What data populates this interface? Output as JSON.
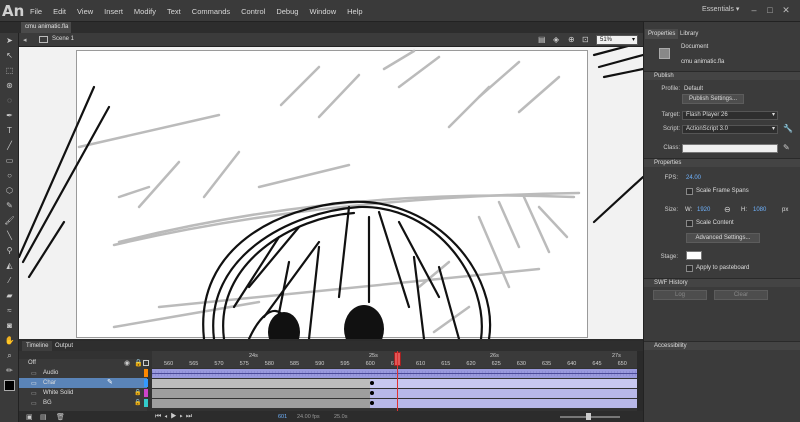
{
  "app": {
    "logo": "An"
  },
  "menu": [
    "File",
    "Edit",
    "View",
    "Insert",
    "Modify",
    "Text",
    "Commands",
    "Control",
    "Debug",
    "Window",
    "Help"
  ],
  "workspace": "Essentials",
  "window_buttons": {
    "minimize": "–",
    "maximize": "□",
    "close": "✕"
  },
  "document_tab": {
    "label": "cmu animatic.fla",
    "close": "×"
  },
  "editbar": {
    "scene": "Scene 1",
    "zoom": "51%"
  },
  "colors": {
    "accent": "#6fb3ff",
    "playhead": "#e03030",
    "purple_frames": "#9999dd",
    "stage": "#ffffff"
  },
  "timeline": {
    "tabs": [
      "Timeline",
      "Output"
    ],
    "off_label": "Off",
    "layers": [
      {
        "name": "Audio",
        "color": "#ff8800",
        "selected": false
      },
      {
        "name": "Char",
        "color": "#3399ff",
        "selected": true
      },
      {
        "name": "White Solid",
        "color": "#cc44cc",
        "selected": false
      },
      {
        "name": "BG",
        "color": "#33cccc",
        "selected": false
      }
    ],
    "frame_numbers": [
      "560",
      "565",
      "570",
      "575",
      "580",
      "585",
      "590",
      "595",
      "600",
      "605",
      "610",
      "615",
      "620",
      "625",
      "630",
      "635",
      "640",
      "645",
      "650"
    ],
    "seconds": [
      "24s",
      "25s",
      "26s",
      "27s"
    ],
    "status": {
      "frame": "601",
      "fps": "24.00 fps",
      "time": "25.0s"
    }
  },
  "properties": {
    "tabs": [
      "Properties",
      "Library"
    ],
    "doc_type": "Document",
    "doc_name": "cmu animatic.fla",
    "publish": {
      "header": "Publish",
      "profile_label": "Profile:",
      "profile_value": "Default",
      "publish_settings_btn": "Publish Settings...",
      "target_label": "Target:",
      "target_value": "Flash Player 26",
      "script_label": "Script:",
      "script_value": "ActionScript 3.0",
      "class_label": "Class:"
    },
    "props": {
      "header": "Properties",
      "fps_label": "FPS:",
      "fps_value": "24.00",
      "scale_frame_spans": "Scale Frame Spans",
      "size_label": "Size:",
      "w_label": "W:",
      "w_value": "1920",
      "h_label": "H:",
      "h_value": "1080",
      "unit": "px",
      "scale_content": "Scale Content",
      "advanced_btn": "Advanced Settings...",
      "stage_label": "Stage:",
      "apply_pasteboard": "Apply to pasteboard"
    },
    "swf_history": {
      "header": "SWF History",
      "log_btn": "Log",
      "clear_btn": "Clear"
    },
    "accessibility": {
      "header": "Accessibility"
    }
  }
}
